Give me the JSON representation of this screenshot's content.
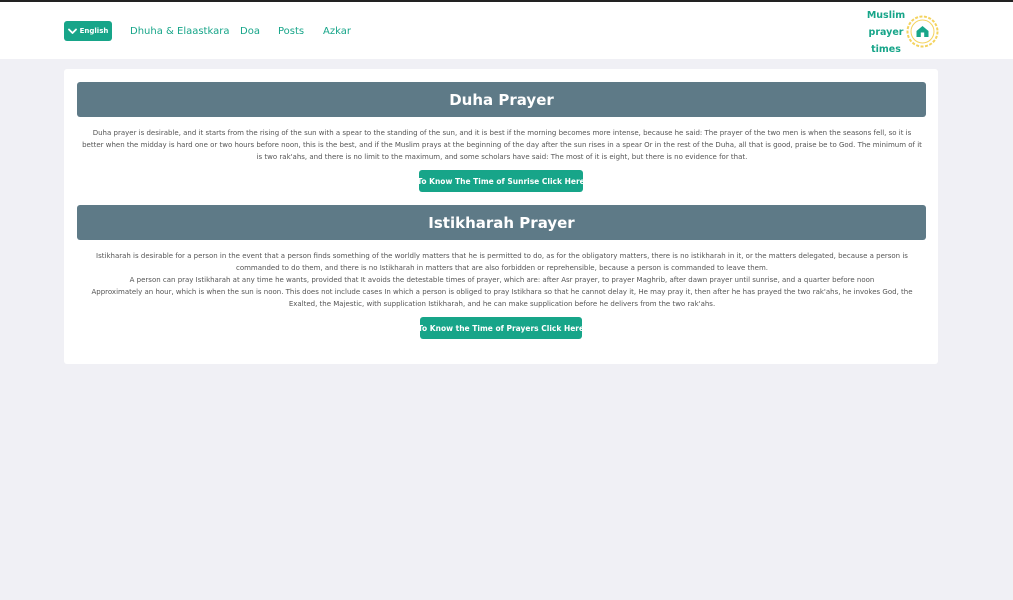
{
  "header": {
    "language_button": {
      "label": "English",
      "icon": "chevron-down-icon"
    },
    "nav": [
      {
        "label": "Dhuha & Elaastkara"
      },
      {
        "label": "Doa"
      },
      {
        "label": "Posts"
      },
      {
        "label": "Azkar"
      }
    ],
    "brand": {
      "line1": "Muslim",
      "line2": "prayer",
      "line3": "times",
      "logo_icon": "mosque-icon"
    }
  },
  "sections": [
    {
      "title": "Duha Prayer",
      "paragraphs": [
        "Duha prayer is desirable, and it starts from the rising of the sun with a spear to the standing of the sun, and it is best if the morning becomes more intense, because he said: The prayer of the two men is when the seasons fell, so it is better when the midday is hard one or two hours before noon, this is the best, and if the Muslim prays at the beginning of the day after the sun rises in a spear Or in the rest of the Duha, all that is good, praise be to God. The minimum of it is two rak'ahs, and there is no limit to the maximum, and some scholars have said: The most of it is eight, but there is no evidence for that."
      ],
      "button_label": "To Know The Time of Sunrise Click Here"
    },
    {
      "title": "Istikharah Prayer",
      "paragraphs": [
        "Istikharah is desirable for a person in the event that a person finds something of the worldly matters that he is permitted to do, as for the obligatory matters, there is no istikharah in it, or the matters delegated, because a person is commanded to do them, and there is no Istikharah in matters that are also forbidden or reprehensible, because a person is commanded to leave them.",
        "A person can pray Istikharah at any time he wants, provided that It avoids the detestable times of prayer, which are: after Asr prayer, to prayer Maghrib, after dawn prayer until sunrise, and a quarter before noon",
        "Approximately an hour, which is when the sun is noon. This does not include cases In which a person is obliged to pray Istikhara so that he cannot delay it, He may pray it, then after he has prayed the two rak'ahs, he invokes God, the Exalted, the Majestic, with supplication Istikharah, and he can make supplication before he delivers from the two rak'ahs."
      ],
      "button_label": "To Know the Time of Prayers Click Here"
    }
  ],
  "colors": {
    "accent": "#17a589",
    "header_bar": "#5e7a87",
    "page_bg": "#f0f0f5",
    "logo_ring": "#f4d35e"
  }
}
